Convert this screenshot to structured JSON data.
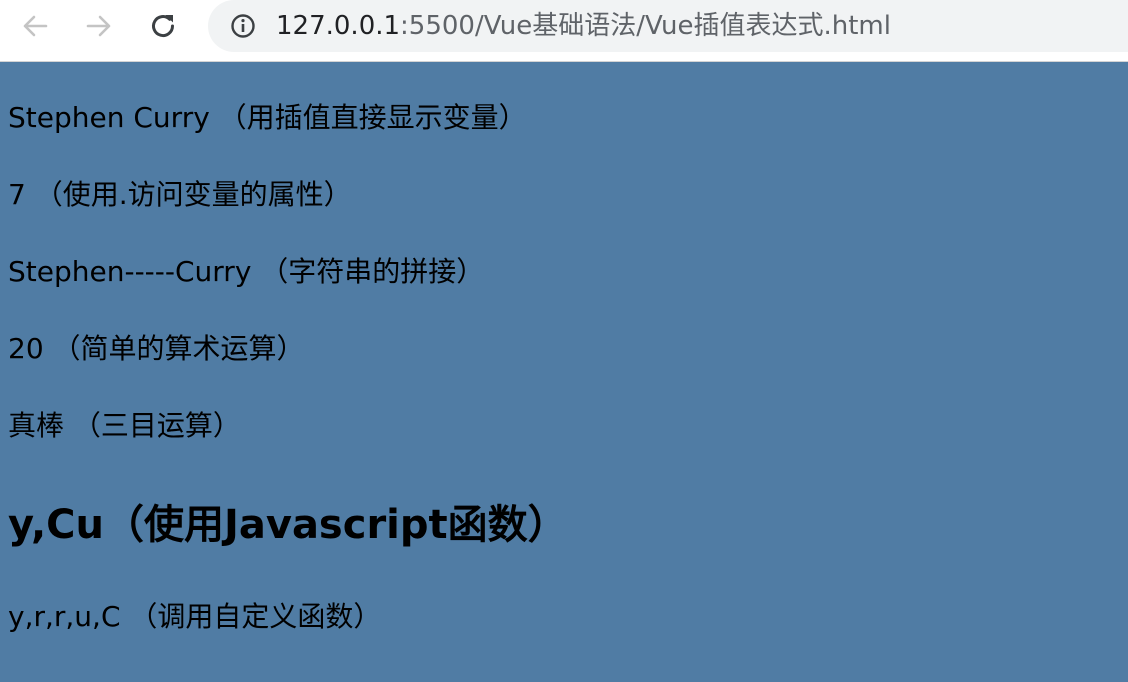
{
  "browser": {
    "url_host": "127.0.0.1",
    "url_port": ":5500",
    "url_path": "/Vue基础语法/Vue插值表达式.html",
    "icons": {
      "back": "arrow-left-icon",
      "forward": "arrow-right-icon",
      "reload": "reload-icon",
      "info": "info-icon"
    }
  },
  "page": {
    "background": "#507ca4",
    "lines": [
      "Stephen Curry （用插值直接显示变量）",
      "7 （使用.访问变量的属性）",
      "Stephen-----Curry （字符串的拼接）",
      "20 （简单的算术运算）",
      "真棒 （三目运算）"
    ],
    "heading": "y,Cu（使用Javascript函数）",
    "last_line": "y,r,r,u,C （调用自定义函数）"
  }
}
